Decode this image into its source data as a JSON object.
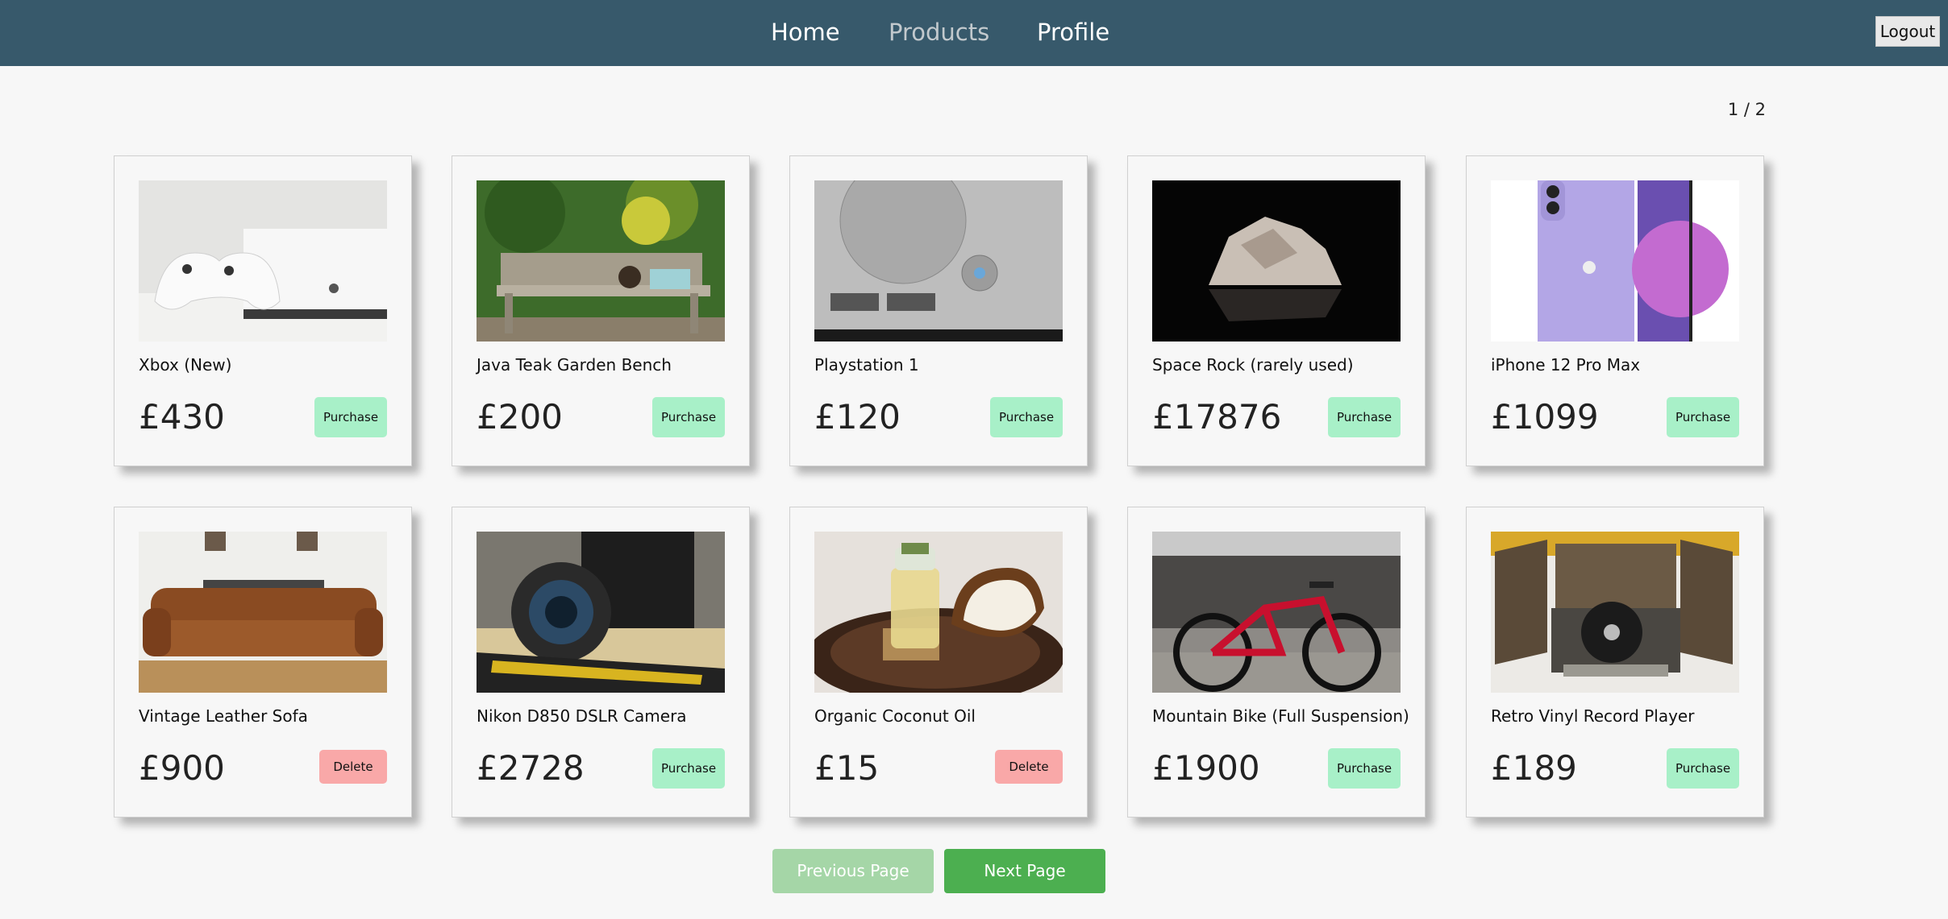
{
  "nav": {
    "home": "Home",
    "products": "Products",
    "profile": "Profile",
    "logout": "Logout"
  },
  "pagination": {
    "indicator": "1 / 2",
    "prev_label": "Previous Page",
    "next_label": "Next Page"
  },
  "products": [
    {
      "name": "Xbox (New)",
      "price": "£430",
      "action": "Purchase"
    },
    {
      "name": "Java Teak Garden Bench",
      "price": "£200",
      "action": "Purchase"
    },
    {
      "name": "Playstation 1",
      "price": "£120",
      "action": "Purchase"
    },
    {
      "name": "Space Rock (rarely used)",
      "price": "£17876",
      "action": "Purchase"
    },
    {
      "name": "iPhone 12 Pro Max",
      "price": "£1099",
      "action": "Purchase"
    },
    {
      "name": "Vintage Leather Sofa",
      "price": "£900",
      "action": "Delete"
    },
    {
      "name": "Nikon D850 DSLR Camera",
      "price": "£2728",
      "action": "Purchase"
    },
    {
      "name": "Organic Coconut Oil",
      "price": "£15",
      "action": "Delete"
    },
    {
      "name": "Mountain Bike (Full Suspension)",
      "price": "£1900",
      "action": "Purchase"
    },
    {
      "name": "Retro Vinyl Record Player",
      "price": "£189",
      "action": "Purchase"
    }
  ],
  "colors": {
    "navbar": "#37596b",
    "purchase": "#a8f0c8",
    "delete": "#f9a8a8",
    "next": "#4caf50",
    "prev": "#a5d6a7"
  }
}
